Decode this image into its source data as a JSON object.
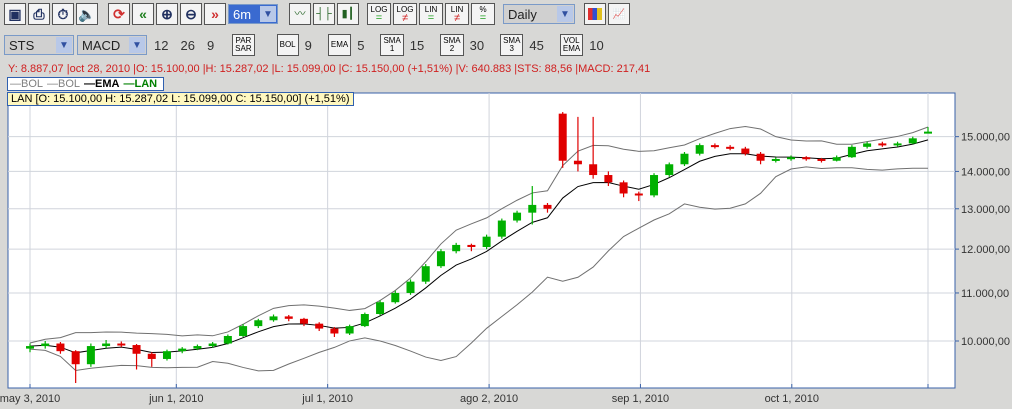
{
  "toolbar": {
    "icons": [
      "new-chart-icon",
      "print-icon",
      "timer-icon",
      "sound-icon",
      "refresh-icon",
      "back-icon",
      "zoom-in-icon",
      "zoom-out-icon",
      "forward-icon"
    ],
    "period": "6m",
    "chart_types": [
      "line-chart-icon",
      "bar-chart-icon",
      "candle-chart-icon"
    ],
    "scale_buttons": [
      {
        "top": "LOG",
        "bottom": "="
      },
      {
        "top": "LOG",
        "bottom": "≠"
      },
      {
        "top": "LIN",
        "bottom": "="
      },
      {
        "top": "LIN",
        "bottom": "≠"
      },
      {
        "top": "%",
        "bottom": "="
      }
    ],
    "interval": "Daily",
    "extra_icons": [
      "colors-icon",
      "chart-settings-icon"
    ]
  },
  "indicators": {
    "osc1": "STS",
    "osc2": "MACD",
    "macd_params": [
      "12",
      "26",
      "9"
    ],
    "items": [
      {
        "label": "PAR SAR",
        "value": ""
      },
      {
        "label": "BOL",
        "value": "9"
      },
      {
        "label": "EMA",
        "value": "5"
      },
      {
        "label": "SMA 1",
        "value": "15"
      },
      {
        "label": "SMA 2",
        "value": "30"
      },
      {
        "label": "SMA 3",
        "value": "45"
      },
      {
        "label": "VOL EMA",
        "value": "10"
      }
    ]
  },
  "info_line": "Y: 8.887,07 |oct 28, 2010 |O: 15.100,00 |H: 15.287,02 |L: 15.099,00 |C: 15.150,00 (+1,51%) |V: 640.883 |STS: 88,56 |MACD: 217,41",
  "legend": [
    {
      "label": "BOL",
      "color": "#808080"
    },
    {
      "label": "BOL",
      "color": "#808080"
    },
    {
      "label": "EMA",
      "color": "#000000"
    },
    {
      "label": "LAN",
      "color": "#008000"
    }
  ],
  "ohlc_box": "LAN [O: 15.100,00  H: 15.287,02  L: 15.099,00  C: 15.150,00] (+1,51%)",
  "chart_data": {
    "type": "candlestick",
    "symbol": "LAN",
    "scale": "log",
    "ylim": [
      9110,
      16360
    ],
    "xlim_days": [
      0,
      178
    ],
    "yticks": [
      {
        "v": 10000,
        "label": "10.000,00"
      },
      {
        "v": 11000,
        "label": "11.000,00"
      },
      {
        "v": 12000,
        "label": "12.000,00"
      },
      {
        "v": 13000,
        "label": "13.000,00"
      },
      {
        "v": 14000,
        "label": "14.000,00"
      },
      {
        "v": 15000,
        "label": "15.000,00"
      }
    ],
    "xticks": [
      {
        "day": 0,
        "label": "may 3, 2010"
      },
      {
        "day": 29,
        "label": "jun 1, 2010"
      },
      {
        "day": 59,
        "label": "jul 1, 2010"
      },
      {
        "day": 91,
        "label": "ago 2, 2010"
      },
      {
        "day": 121,
        "label": "sep 1, 2010"
      },
      {
        "day": 151,
        "label": "oct 1, 2010"
      },
      {
        "day": 178,
        "label": ""
      }
    ],
    "up_color": "#00b000",
    "down_color": "#e00000",
    "bol_period": 9,
    "ema_period": 5,
    "candles": [
      [
        9850,
        9950,
        9780,
        9900
      ],
      [
        9900,
        10000,
        9850,
        9950
      ],
      [
        9950,
        9980,
        9750,
        9800
      ],
      [
        9800,
        9820,
        9200,
        9550
      ],
      [
        9550,
        9950,
        9500,
        9900
      ],
      [
        9900,
        10020,
        9860,
        9950
      ],
      [
        9950,
        9990,
        9880,
        9920
      ],
      [
        9920,
        9940,
        9450,
        9750
      ],
      [
        9750,
        9780,
        9500,
        9650
      ],
      [
        9650,
        9830,
        9620,
        9800
      ],
      [
        9800,
        9880,
        9760,
        9850
      ],
      [
        9850,
        9930,
        9820,
        9900
      ],
      [
        9900,
        9980,
        9870,
        9950
      ],
      [
        9950,
        10130,
        9930,
        10100
      ],
      [
        10100,
        10340,
        10080,
        10300
      ],
      [
        10300,
        10450,
        10260,
        10420
      ],
      [
        10420,
        10540,
        10390,
        10500
      ],
      [
        10500,
        10530,
        10400,
        10450
      ],
      [
        10450,
        10470,
        10300,
        10350
      ],
      [
        10350,
        10380,
        10200,
        10250
      ],
      [
        10250,
        10280,
        10080,
        10150
      ],
      [
        10150,
        10330,
        10120,
        10300
      ],
      [
        10300,
        10580,
        10280,
        10550
      ],
      [
        10550,
        10840,
        10520,
        10800
      ],
      [
        10800,
        11050,
        10770,
        11000
      ],
      [
        11000,
        11300,
        10960,
        11250
      ],
      [
        11250,
        11650,
        11200,
        11600
      ],
      [
        11600,
        12000,
        11560,
        11950
      ],
      [
        11950,
        12150,
        11900,
        12100
      ],
      [
        12100,
        12130,
        11950,
        12050
      ],
      [
        12050,
        12350,
        12000,
        12300
      ],
      [
        12300,
        12750,
        12250,
        12700
      ],
      [
        12700,
        12950,
        12650,
        12900
      ],
      [
        12900,
        13600,
        12600,
        13100
      ],
      [
        13100,
        13150,
        12900,
        13000
      ],
      [
        15700,
        15750,
        14100,
        14300
      ],
      [
        14300,
        15600,
        14000,
        14200
      ],
      [
        14200,
        15600,
        13800,
        13900
      ],
      [
        13900,
        14000,
        13600,
        13700
      ],
      [
        13700,
        13750,
        13300,
        13400
      ],
      [
        13400,
        13450,
        13200,
        13350
      ],
      [
        13350,
        13950,
        13300,
        13900
      ],
      [
        13900,
        14250,
        13850,
        14200
      ],
      [
        14200,
        14550,
        14150,
        14500
      ],
      [
        14500,
        14800,
        14450,
        14750
      ],
      [
        14750,
        14800,
        14650,
        14700
      ],
      [
        14700,
        14750,
        14600,
        14650
      ],
      [
        14650,
        14700,
        14450,
        14500
      ],
      [
        14500,
        14550,
        14200,
        14300
      ],
      [
        14300,
        14400,
        14250,
        14350
      ],
      [
        14350,
        14450,
        14300,
        14400
      ],
      [
        14400,
        14430,
        14300,
        14350
      ],
      [
        14350,
        14380,
        14250,
        14300
      ],
      [
        14300,
        14450,
        14280,
        14400
      ],
      [
        14400,
        14750,
        14380,
        14700
      ],
      [
        14700,
        14850,
        14650,
        14800
      ],
      [
        14800,
        14850,
        14700,
        14750
      ],
      [
        14750,
        14850,
        14700,
        14800
      ],
      [
        14800,
        15000,
        14780,
        14950
      ],
      [
        15100,
        15287,
        15099,
        15150
      ]
    ]
  }
}
